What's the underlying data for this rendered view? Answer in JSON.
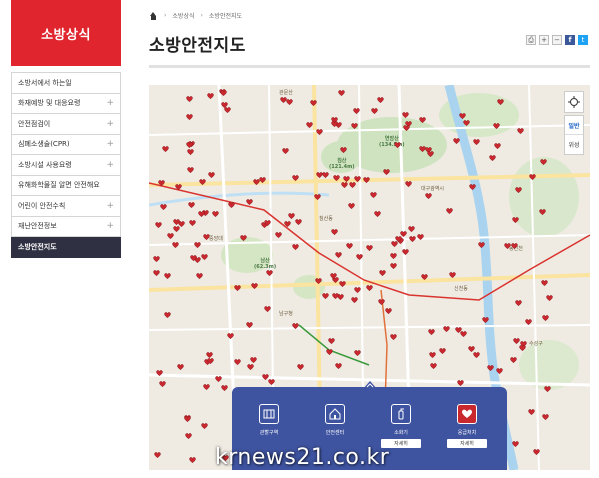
{
  "sidebar": {
    "title": "소방상식",
    "items": [
      {
        "label": "소방서에서 하는일",
        "plus": ""
      },
      {
        "label": "화재예방 및 대응요령",
        "plus": "+"
      },
      {
        "label": "안전점검이",
        "plus": "+"
      },
      {
        "label": "심폐소생술(CPR)",
        "plus": "+"
      },
      {
        "label": "소방시설 사용요령",
        "plus": "+"
      },
      {
        "label": "유해화학물질 알면 안전해요",
        "plus": ""
      },
      {
        "label": "어린이 안전수칙",
        "plus": "+"
      },
      {
        "label": "재난안전정보",
        "plus": "+"
      },
      {
        "label": "소방안전지도",
        "plus": ""
      }
    ],
    "active_index": 8
  },
  "breadcrumb": [
    "소방상식",
    "소방안전지도"
  ],
  "page_title": "소방안전지도",
  "tools": {
    "print": "⎙",
    "plus": "+",
    "minus": "−",
    "facebook": "f",
    "twitter": "t"
  },
  "map": {
    "type_on": "일반",
    "type_off": "위성",
    "places": [
      {
        "text": "관문산"
      },
      {
        "text": "연암산\n(134.5m)"
      },
      {
        "text": "침산\n(121.4m)"
      },
      {
        "text": "남산\n(62.3m)"
      },
      {
        "text": "대구광역시"
      },
      {
        "text": "침산동"
      },
      {
        "text": "중앙대"
      },
      {
        "text": "남구청"
      },
      {
        "text": "수성구"
      },
      {
        "text": "신천동"
      },
      {
        "text": "동신천"
      }
    ]
  },
  "legend": {
    "items": [
      {
        "label": "관할구역",
        "icon": "map-icon",
        "button": ""
      },
      {
        "label": "안전센터",
        "icon": "building-icon",
        "button": ""
      },
      {
        "label": "소화기",
        "icon": "extinguisher-icon",
        "button": "자세히"
      },
      {
        "label": "응급처치",
        "icon": "heart-icon",
        "button": "자세히"
      }
    ],
    "selected_index": 3
  },
  "watermark": "krnews21.co.kr",
  "colors": {
    "brand": "#e0252e",
    "active": "#2f3142",
    "panel": "#3f54a1",
    "pin": "#c9282f"
  }
}
